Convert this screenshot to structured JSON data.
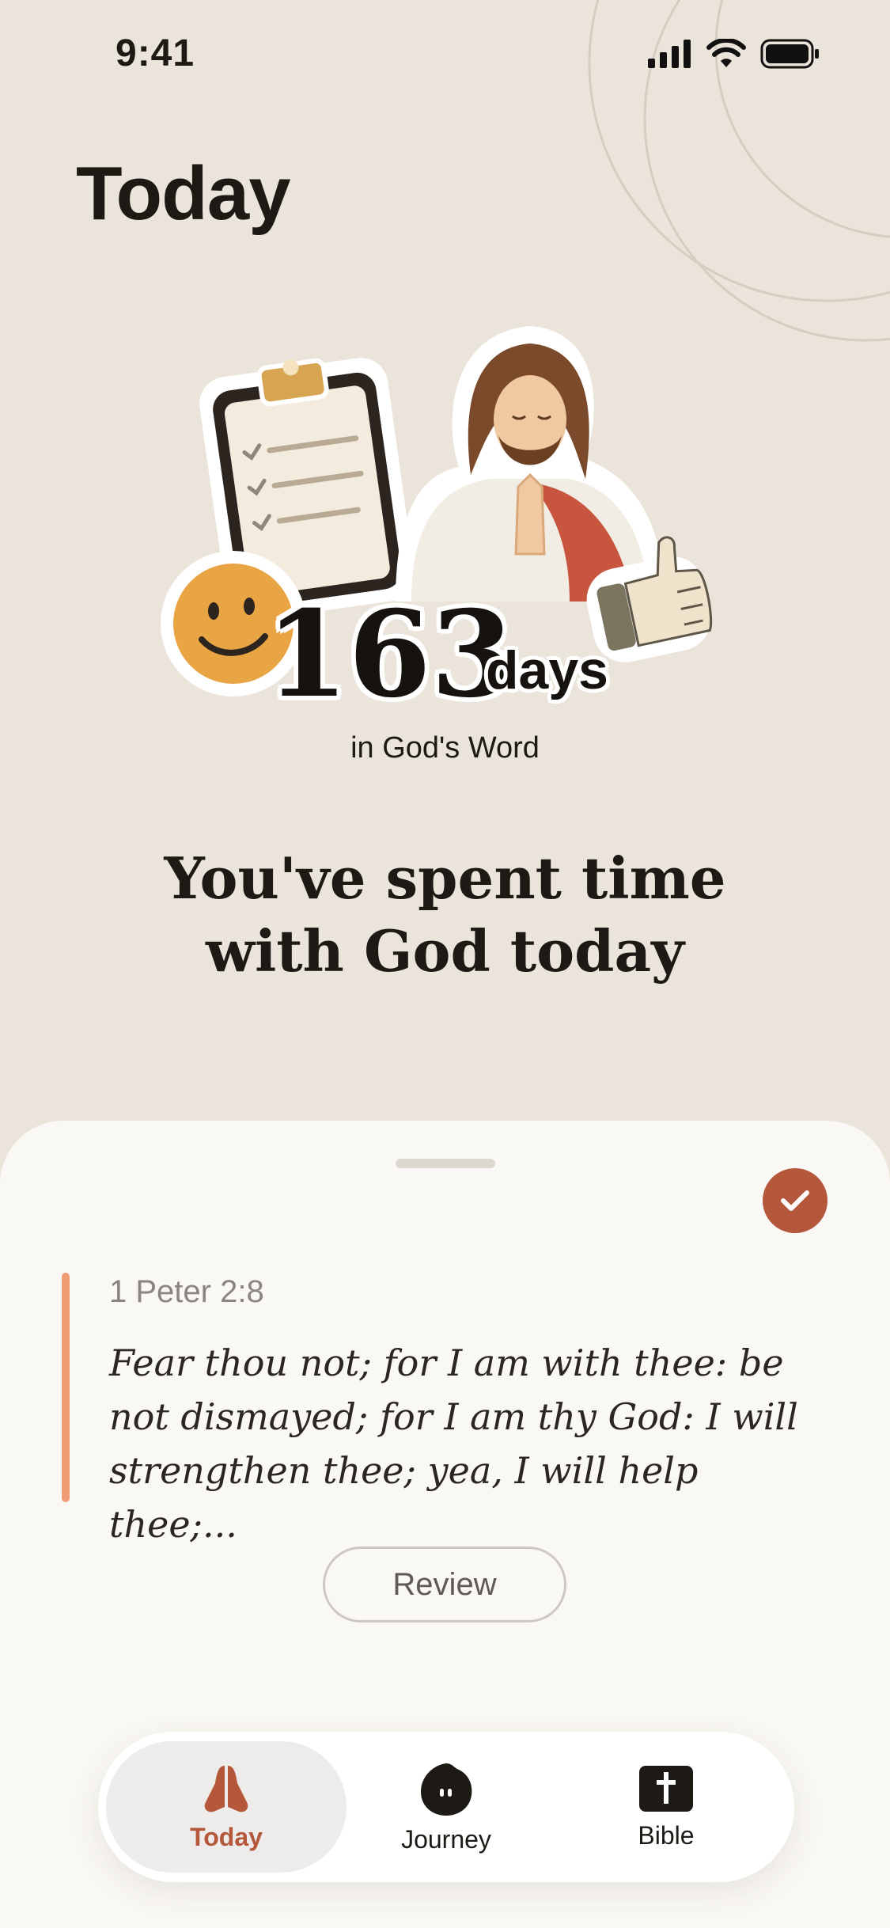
{
  "status_bar": {
    "time": "9:41"
  },
  "page_title": "Today",
  "streak": {
    "number": "163",
    "unit": "days",
    "caption": "in God's Word"
  },
  "headline": {
    "line1": "You've spent time",
    "line2": "with God today"
  },
  "verse": {
    "reference": "1 Peter 2:8",
    "text": "Fear thou not; for I am with thee: be not dismayed; for I am thy God: I will strengthen thee; yea, I will help thee;..."
  },
  "review_label": "Review",
  "tabs": [
    {
      "label": "Today",
      "icon": "praying-hands-icon",
      "active": true
    },
    {
      "label": "Journey",
      "icon": "journey-blob-icon",
      "active": false
    },
    {
      "label": "Bible",
      "icon": "bible-icon",
      "active": false
    }
  ],
  "colors": {
    "background": "#ebe4da",
    "accent": "#b4573a",
    "verse_bar": "#ef9b74",
    "sheet": "#faf8f4"
  }
}
